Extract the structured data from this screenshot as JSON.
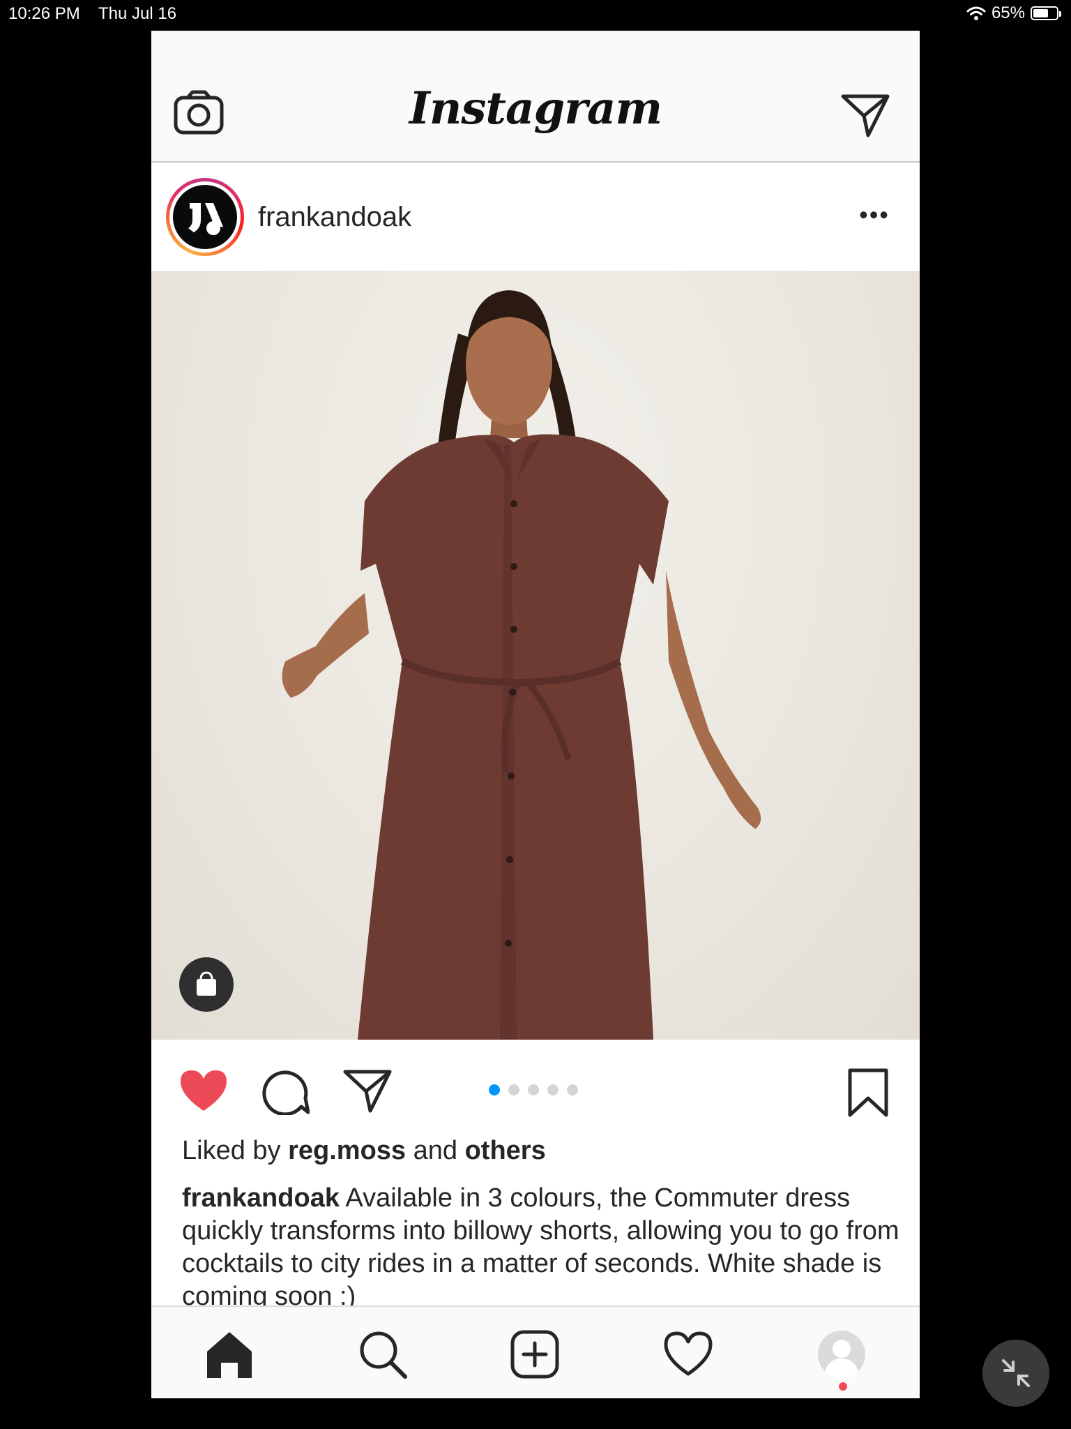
{
  "status_bar": {
    "time": "10:26 PM",
    "date": "Thu Jul 16",
    "battery_text": "65%",
    "battery_level": 0.65
  },
  "header": {
    "logo": "Instagram",
    "camera_icon": "camera-icon",
    "direct_icon": "paper-plane-icon"
  },
  "post": {
    "username": "frankandoak",
    "more_icon": "more-horizontal-icon",
    "more_glyph": "•••",
    "image_alt": "Model wearing a brown short-sleeve shirt dress with belt",
    "shop_icon": "shopping-bag-icon",
    "carousel": {
      "count": 5,
      "active_index": 0,
      "active_color": "#0095f6"
    },
    "liked": true,
    "like_color": "#ed4956",
    "likes": {
      "prefix": "Liked by ",
      "user": "reg.moss",
      "middle": " and ",
      "others": "others"
    },
    "caption": {
      "user": "frankandoak",
      "text": " Available in 3 colours, the Commuter dress quickly transforms into billowy shorts, allowing you to go from cocktails to city rides in a matter of seconds. White shade is coming soon :)"
    }
  },
  "bottom_nav": {
    "items": [
      "home-icon",
      "search-icon",
      "new-post-icon",
      "activity-heart-icon",
      "profile-icon"
    ],
    "active": "home-icon",
    "notification_color": "#ed4956"
  },
  "overlay": {
    "minimize_icon": "exit-fullscreen-icon"
  }
}
